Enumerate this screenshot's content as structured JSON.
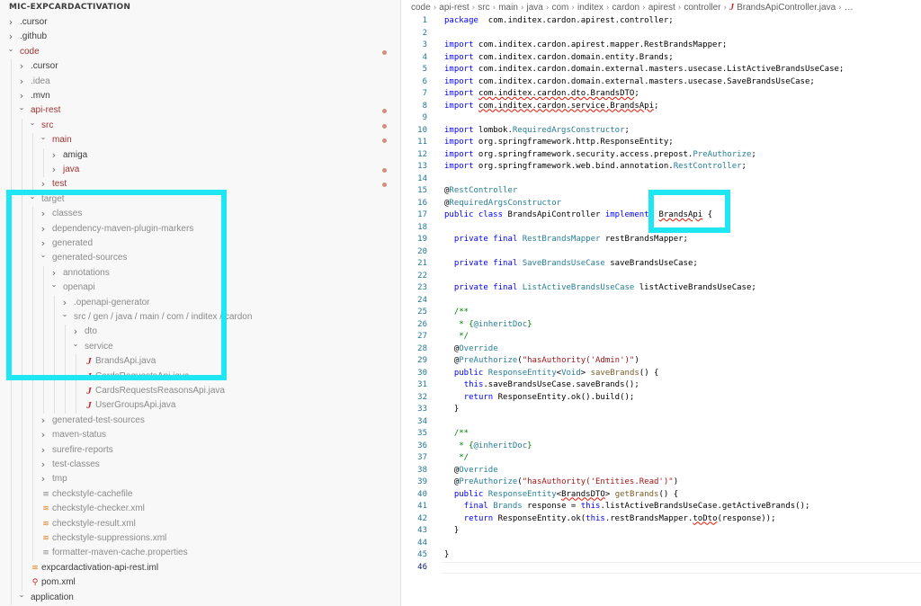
{
  "explorer": {
    "title": "MIC-EXPCARDACTIVATION",
    "items": [
      {
        "label": ".cursor",
        "level": 0,
        "type": "folder",
        "expanded": false,
        "color": "#3c3c3c",
        "modified": false
      },
      {
        "label": ".github",
        "level": 0,
        "type": "folder",
        "expanded": false,
        "color": "#3c3c3c",
        "modified": false
      },
      {
        "label": "code",
        "level": 0,
        "type": "folder",
        "expanded": true,
        "color": "#9e3331",
        "modified": true
      },
      {
        "label": ".cursor",
        "level": 1,
        "type": "folder",
        "expanded": false,
        "color": "#3c3c3c",
        "modified": false
      },
      {
        "label": ".idea",
        "level": 1,
        "type": "folder",
        "expanded": false,
        "color": "#8a8a8a",
        "modified": false
      },
      {
        "label": ".mvn",
        "level": 1,
        "type": "folder",
        "expanded": false,
        "color": "#3c3c3c",
        "modified": false
      },
      {
        "label": "api-rest",
        "level": 1,
        "type": "folder",
        "expanded": true,
        "color": "#9e3331",
        "modified": true
      },
      {
        "label": "src",
        "level": 2,
        "type": "folder",
        "expanded": true,
        "color": "#9e3331",
        "modified": true
      },
      {
        "label": "main",
        "level": 3,
        "type": "folder",
        "expanded": true,
        "color": "#9e3331",
        "modified": true
      },
      {
        "label": "amiga",
        "level": 4,
        "type": "folder",
        "expanded": false,
        "color": "#3c3c3c",
        "modified": false
      },
      {
        "label": "java",
        "level": 4,
        "type": "folder",
        "expanded": false,
        "color": "#9e3331",
        "modified": true
      },
      {
        "label": "test",
        "level": 3,
        "type": "folder",
        "expanded": false,
        "color": "#9e3331",
        "modified": true
      },
      {
        "label": "target",
        "level": 2,
        "type": "folder",
        "expanded": true,
        "color": "#8a8a8a",
        "modified": false
      },
      {
        "label": "classes",
        "level": 3,
        "type": "folder",
        "expanded": false,
        "color": "#8a8a8a",
        "modified": false
      },
      {
        "label": "dependency-maven-plugin-markers",
        "level": 3,
        "type": "folder",
        "expanded": false,
        "color": "#8a8a8a",
        "modified": false
      },
      {
        "label": "generated",
        "level": 3,
        "type": "folder",
        "expanded": false,
        "color": "#8a8a8a",
        "modified": false
      },
      {
        "label": "generated-sources",
        "level": 3,
        "type": "folder",
        "expanded": true,
        "color": "#8a8a8a",
        "modified": false
      },
      {
        "label": "annotations",
        "level": 4,
        "type": "folder",
        "expanded": false,
        "color": "#8a8a8a",
        "modified": false
      },
      {
        "label": "openapi",
        "level": 4,
        "type": "folder",
        "expanded": true,
        "color": "#8a8a8a",
        "modified": false
      },
      {
        "label": ".openapi-generator",
        "level": 5,
        "type": "folder",
        "expanded": false,
        "color": "#8a8a8a",
        "modified": false
      },
      {
        "label": "src / gen / java / main / com / inditex / cardon",
        "level": 5,
        "type": "folder",
        "expanded": true,
        "color": "#8a8a8a",
        "modified": false
      },
      {
        "label": "dto",
        "level": 6,
        "type": "folder",
        "expanded": false,
        "color": "#8a8a8a",
        "modified": false
      },
      {
        "label": "service",
        "level": 6,
        "type": "folder",
        "expanded": true,
        "color": "#8a8a8a",
        "modified": false
      },
      {
        "label": "BrandsApi.java",
        "level": 7,
        "type": "java",
        "color": "#8a8a8a",
        "modified": false
      },
      {
        "label": "CardsRequestsApi.java",
        "level": 7,
        "type": "java",
        "color": "#8a8a8a",
        "modified": false
      },
      {
        "label": "CardsRequestsReasonsApi.java",
        "level": 7,
        "type": "java",
        "color": "#8a8a8a",
        "modified": false
      },
      {
        "label": "UserGroupsApi.java",
        "level": 7,
        "type": "java",
        "color": "#8a8a8a",
        "modified": false
      },
      {
        "label": "generated-test-sources",
        "level": 3,
        "type": "folder",
        "expanded": false,
        "color": "#8a8a8a",
        "modified": false
      },
      {
        "label": "maven-status",
        "level": 3,
        "type": "folder",
        "expanded": false,
        "color": "#8a8a8a",
        "modified": false
      },
      {
        "label": "surefire-reports",
        "level": 3,
        "type": "folder",
        "expanded": false,
        "color": "#8a8a8a",
        "modified": false
      },
      {
        "label": "test-classes",
        "level": 3,
        "type": "folder",
        "expanded": false,
        "color": "#8a8a8a",
        "modified": false
      },
      {
        "label": "tmp",
        "level": 3,
        "type": "folder",
        "expanded": false,
        "color": "#8a8a8a",
        "modified": false
      },
      {
        "label": "checkstyle-cachefile",
        "level": 3,
        "type": "file",
        "color": "#8a8a8a",
        "modified": false
      },
      {
        "label": "checkstyle-checker.xml",
        "level": 3,
        "type": "xml",
        "color": "#8a8a8a",
        "modified": false
      },
      {
        "label": "checkstyle-result.xml",
        "level": 3,
        "type": "xml",
        "color": "#8a8a8a",
        "modified": false
      },
      {
        "label": "checkstyle-suppressions.xml",
        "level": 3,
        "type": "xml",
        "color": "#8a8a8a",
        "modified": false
      },
      {
        "label": "formatter-maven-cache.properties",
        "level": 3,
        "type": "file",
        "color": "#8a8a8a",
        "modified": false
      },
      {
        "label": "expcardactivation-api-rest.iml",
        "level": 2,
        "type": "xml",
        "color": "#3c3c3c",
        "modified": false
      },
      {
        "label": "pom.xml",
        "level": 2,
        "type": "pom",
        "color": "#3c3c3c",
        "modified": false
      },
      {
        "label": "application",
        "level": 1,
        "type": "folder",
        "expanded": true,
        "color": "#3c3c3c",
        "modified": false
      }
    ]
  },
  "breadcrumb": [
    "code",
    "api-rest",
    "src",
    "main",
    "java",
    "com",
    "inditex",
    "cardon",
    "apirest",
    "controller"
  ],
  "breadcrumb_file": "BrandsApiController.java",
  "breadcrumb_more": "…",
  "colors": {
    "highlight": "#1ee6f2",
    "modified_dot": "#d48d80",
    "modified_text": "#9e3331",
    "line_number": "#237893"
  },
  "editor": {
    "current_line": 46,
    "lines": [
      [
        [
          "kw",
          "package"
        ],
        [
          "",
          "  com.inditex.cardon.apirest.controller;"
        ]
      ],
      [],
      [
        [
          "kw",
          "import"
        ],
        [
          "",
          " com.inditex.cardon.apirest.mapper.RestBrandsMapper;"
        ]
      ],
      [
        [
          "kw",
          "import"
        ],
        [
          "",
          " com.inditex.cardon.domain.entity.Brands;"
        ]
      ],
      [
        [
          "kw",
          "import"
        ],
        [
          "",
          " com.inditex.cardon.domain.external.masters.usecase.ListActiveBrandsUseCase;"
        ]
      ],
      [
        [
          "kw",
          "import"
        ],
        [
          "",
          " com.inditex.cardon.domain.external.masters.usecase.SaveBrandsUseCase;"
        ]
      ],
      [
        [
          "kw",
          "import"
        ],
        [
          "",
          " "
        ],
        [
          "sq",
          "com.inditex.cardon.dto.BrandsDTO"
        ],
        [
          "",
          ";"
        ]
      ],
      [
        [
          "kw",
          "import"
        ],
        [
          "",
          " "
        ],
        [
          "sq",
          "com.inditex.cardon.service.BrandsApi"
        ],
        [
          "",
          ";"
        ]
      ],
      [],
      [
        [
          "kw",
          "import"
        ],
        [
          "",
          " lombok."
        ],
        [
          "ty",
          "RequiredArgsConstructor"
        ],
        [
          "",
          ";"
        ]
      ],
      [
        [
          "kw",
          "import"
        ],
        [
          "",
          " org.springframework.http.ResponseEntity;"
        ]
      ],
      [
        [
          "kw",
          "import"
        ],
        [
          "",
          " org.springframework.security.access.prepost."
        ],
        [
          "ty",
          "PreAuthorize"
        ],
        [
          "",
          ";"
        ]
      ],
      [
        [
          "kw",
          "import"
        ],
        [
          "",
          " org.springframework.web.bind.annotation."
        ],
        [
          "ty",
          "RestController"
        ],
        [
          "",
          ";"
        ]
      ],
      [],
      [
        [
          "",
          "@"
        ],
        [
          "ty",
          "RestController"
        ]
      ],
      [
        [
          "",
          "@"
        ],
        [
          "ty",
          "RequiredArgsConstructor"
        ]
      ],
      [
        [
          "kw",
          "public class"
        ],
        [
          "",
          " BrandsApiController "
        ],
        [
          "kw",
          "implements"
        ],
        [
          "",
          " "
        ],
        [
          "sq",
          "BrandsApi"
        ],
        [
          "",
          " {"
        ]
      ],
      [],
      [
        [
          "",
          "  "
        ],
        [
          "kw",
          "private final"
        ],
        [
          "",
          " "
        ],
        [
          "ty",
          "RestBrandsMapper"
        ],
        [
          "",
          " restBrandsMapper;"
        ]
      ],
      [],
      [
        [
          "",
          "  "
        ],
        [
          "kw",
          "private final"
        ],
        [
          "",
          " "
        ],
        [
          "ty",
          "SaveBrandsUseCase"
        ],
        [
          "",
          " saveBrandsUseCase;"
        ]
      ],
      [],
      [
        [
          "",
          "  "
        ],
        [
          "kw",
          "private final"
        ],
        [
          "",
          " "
        ],
        [
          "ty",
          "ListActiveBrandsUseCase"
        ],
        [
          "",
          " listActiveBrandsUseCase;"
        ]
      ],
      [],
      [
        [
          "cm",
          "  /**"
        ]
      ],
      [
        [
          "cm",
          "   * {"
        ],
        [
          "ty",
          "@inheritDoc"
        ],
        [
          "cm",
          "}"
        ]
      ],
      [
        [
          "cm",
          "   */"
        ]
      ],
      [
        [
          "",
          "  @"
        ],
        [
          "ty",
          "Override"
        ]
      ],
      [
        [
          "",
          "  @"
        ],
        [
          "ty",
          "PreAuthorize"
        ],
        [
          "",
          "("
        ],
        [
          "st",
          "\"hasAuthority('Admin')\""
        ],
        [
          "",
          ")"
        ]
      ],
      [
        [
          "",
          "  "
        ],
        [
          "kw",
          "public"
        ],
        [
          "",
          " "
        ],
        [
          "ty",
          "ResponseEntity"
        ],
        [
          "",
          "<"
        ],
        [
          "ty",
          "Void"
        ],
        [
          "",
          "> "
        ],
        [
          "fn",
          "saveBrands"
        ],
        [
          "",
          "() {"
        ]
      ],
      [
        [
          "",
          "    "
        ],
        [
          "kw",
          "this"
        ],
        [
          "",
          ".saveBrandsUseCase.saveBrands();"
        ]
      ],
      [
        [
          "",
          "    "
        ],
        [
          "kw",
          "return"
        ],
        [
          "",
          " ResponseEntity.ok().build();"
        ]
      ],
      [
        [
          "",
          "  }"
        ]
      ],
      [],
      [
        [
          "cm",
          "  /**"
        ]
      ],
      [
        [
          "cm",
          "   * {"
        ],
        [
          "ty",
          "@inheritDoc"
        ],
        [
          "cm",
          "}"
        ]
      ],
      [
        [
          "cm",
          "   */"
        ]
      ],
      [
        [
          "",
          "  @"
        ],
        [
          "ty",
          "Override"
        ]
      ],
      [
        [
          "",
          "  @"
        ],
        [
          "ty",
          "PreAuthorize"
        ],
        [
          "",
          "("
        ],
        [
          "st",
          "\"hasAuthority('Entities.Read')\""
        ],
        [
          "",
          ")"
        ]
      ],
      [
        [
          "",
          "  "
        ],
        [
          "kw",
          "public"
        ],
        [
          "",
          " "
        ],
        [
          "ty",
          "ResponseEntity"
        ],
        [
          "",
          "<"
        ],
        [
          "sq",
          "BrandsDTO"
        ],
        [
          "",
          "> "
        ],
        [
          "fn",
          "getBrands"
        ],
        [
          "",
          "() {"
        ]
      ],
      [
        [
          "",
          "    "
        ],
        [
          "kw",
          "final"
        ],
        [
          "",
          " "
        ],
        [
          "ty",
          "Brands"
        ],
        [
          "",
          " response = "
        ],
        [
          "kw",
          "this"
        ],
        [
          "",
          ".listActiveBrandsUseCase.getActiveBrands();"
        ]
      ],
      [
        [
          "",
          "    "
        ],
        [
          "kw",
          "return"
        ],
        [
          "",
          " ResponseEntity.ok("
        ],
        [
          "kw",
          "this"
        ],
        [
          "",
          ".restBrandsMapper."
        ],
        [
          "sq",
          "toDto"
        ],
        [
          "",
          "(response));"
        ]
      ],
      [
        [
          "",
          "  }"
        ]
      ],
      [],
      [
        [
          "",
          "}"
        ]
      ],
      []
    ]
  }
}
